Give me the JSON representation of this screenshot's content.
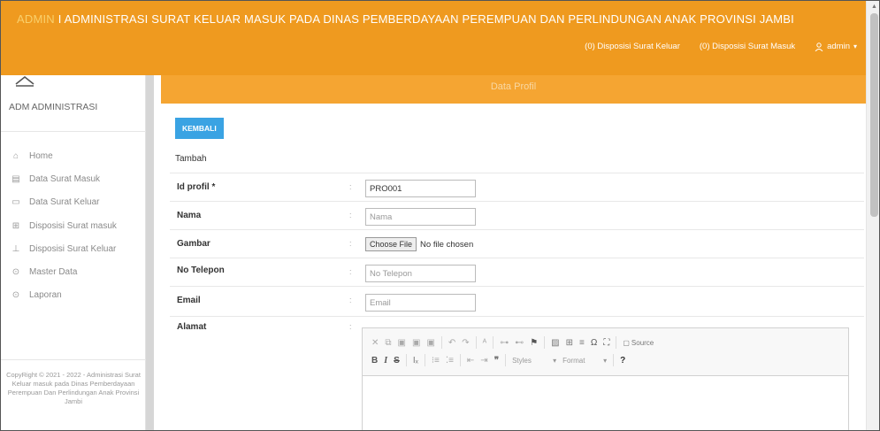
{
  "header": {
    "brand_highlight": "ADMIN",
    "brand_text": " I ADMINISTRASI SURAT KELUAR MASUK PADA DINAS PEMBERDAYAAN PEREMPUAN DAN PERLINDUNGAN ANAK PROVINSI JAMBI",
    "nav": {
      "disposisi_keluar": "(0) Disposisi Surat Keluar",
      "disposisi_masuk": "(0) Disposisi Surat Masuk",
      "user": "admin"
    }
  },
  "sidebar": {
    "title": "ADM ADMINISTRASI",
    "items": [
      {
        "label": "Home",
        "icon": "home-icon"
      },
      {
        "label": "Data Surat Masuk",
        "icon": "document-icon"
      },
      {
        "label": "Data Surat Keluar",
        "icon": "folder-icon"
      },
      {
        "label": "Disposisi Surat masuk",
        "icon": "inbox-icon"
      },
      {
        "label": "Disposisi Surat Keluar",
        "icon": "outbox-icon"
      },
      {
        "label": "Master Data",
        "icon": "circle-chevron-icon"
      },
      {
        "label": "Laporan",
        "icon": "circle-chevron-icon"
      }
    ],
    "copyright": "CopyRight © 2021 - 2022 - Administrasi Surat Keluar masuk pada Dinas Pemberdayaan Perempuan Dan Perlindungan Anak Provinsi Jambi"
  },
  "panel": {
    "title": "Data Profil",
    "back_button": "KEMBALI",
    "subtitle": "Tambah"
  },
  "form": {
    "id_profil": {
      "label": "Id profil *",
      "value": "PRO001"
    },
    "nama": {
      "label": "Nama",
      "placeholder": "Nama"
    },
    "gambar": {
      "label": "Gambar",
      "button": "Choose File",
      "status": "No file chosen"
    },
    "telepon": {
      "label": "No Telepon",
      "placeholder": "No Telepon"
    },
    "email": {
      "label": "Email",
      "placeholder": "Email"
    },
    "alamat": {
      "label": "Alamat"
    },
    "colon": ":"
  },
  "editor": {
    "source_label": "Source",
    "styles_label": "Styles",
    "format_label": "Format",
    "help": "?"
  },
  "colors": {
    "topbar": "#ef9a1f",
    "panel_header": "#f5a532",
    "button": "#3aa3e3"
  }
}
